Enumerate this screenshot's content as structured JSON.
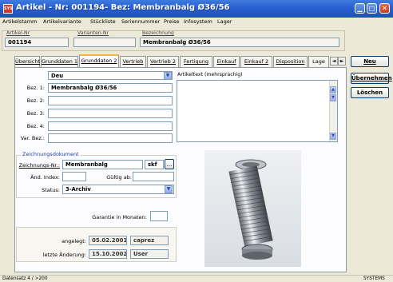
{
  "window": {
    "app_icon_text": "SYS",
    "title": "Artikel - Nr: 001194-    Bez: Membranbalg Ø36/56"
  },
  "menu": [
    "Artikelstamm",
    "Artikelvariante",
    "Stückliste",
    "Seriennummer",
    "Preise",
    "Infosystem",
    "Lager"
  ],
  "header": {
    "artikel_nr_label": "Artikel-Nr",
    "artikel_nr_value": "001194",
    "varianten_nr_label": "Varianten-Nr",
    "varianten_nr_value": "",
    "bezeichnung_label": "Bezeichnung",
    "bezeichnung_value": "Membranbalg Ø36/56"
  },
  "tabs": [
    "Übersicht",
    "Grunddaten 1",
    "Grunddaten 2",
    "Vertrieb",
    "Vertrieb 2",
    "Fertigung",
    "Einkauf",
    "Einkauf 2",
    "Disposition",
    "Lage"
  ],
  "tab_scroll": {
    "left": "◄",
    "right": "►"
  },
  "language": {
    "value": "Deu"
  },
  "artikeltext_label": "Artikeltext (mehrsprachig)",
  "bez_fields": {
    "labels": [
      "Bez. 1:",
      "Bez. 2:",
      "Bez. 3:",
      "Bez. 4:",
      "Var. Bez.:"
    ],
    "values": [
      "Membranbalg Ø36/56",
      "",
      "",
      "",
      ""
    ]
  },
  "drawing": {
    "group_title": "Zeichnungsdokument",
    "nr_label": "Zeichnungs-Nr.:",
    "nr_value": "Membranbalg",
    "ext_value": "skf",
    "browse_label": "...",
    "aend_label": "Änd. Index:",
    "aend_value": "",
    "gueltig_label": "Gültig ab:",
    "gueltig_value": "",
    "status_label": "Status:",
    "status_value": "3-Archiv"
  },
  "garantie": {
    "label": "Garantie in Monaten:",
    "value": ""
  },
  "audit": {
    "angelegt_label": "angelegt:",
    "angelegt_date": "05.02.2001",
    "angelegt_user": "caprez",
    "aenderung_label": "letzte Änderung:",
    "aenderung_date": "15.10.2002",
    "aenderung_user": "User"
  },
  "buttons": {
    "neu": "Neu",
    "uebernehmen": "Übernehmen",
    "loeschen": "Löschen"
  },
  "status_bar": {
    "left": "Datensatz 4 / >200",
    "right": "SYSTEMS"
  },
  "icons": {
    "minimize": "minimize-icon",
    "maximize": "maximize-icon",
    "close": "close-icon",
    "dropdown": "chevron-down-icon",
    "scroll_up": "scroll-up-icon",
    "scroll_down": "scroll-down-icon"
  },
  "colors": {
    "titlebar": "#2a5fcf",
    "tab_highlight": "#f1b435",
    "border": "#7f9db9"
  }
}
